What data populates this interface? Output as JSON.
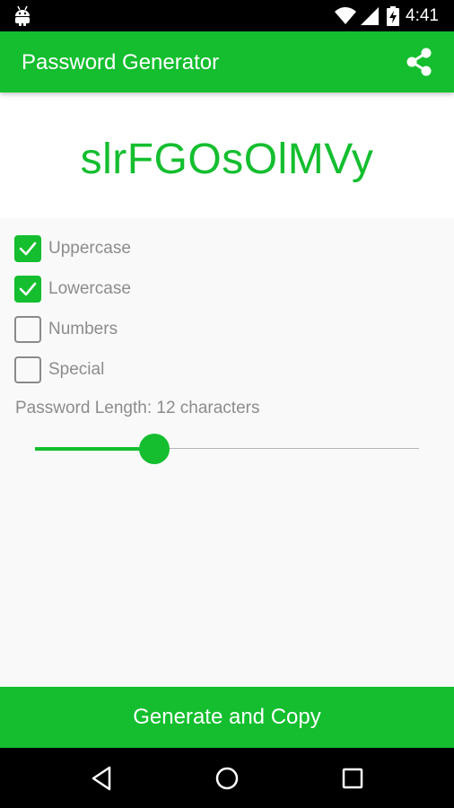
{
  "status_bar": {
    "time": "4:41",
    "icons": [
      "android-icon",
      "wifi-icon",
      "signal-icon",
      "battery-charging-icon"
    ]
  },
  "app_bar": {
    "title": "Password Generator",
    "action_icon": "share-icon"
  },
  "password": {
    "value": "slrFGOsOlMVy"
  },
  "options": [
    {
      "label": "Uppercase",
      "checked": true
    },
    {
      "label": "Lowercase",
      "checked": true
    },
    {
      "label": "Numbers",
      "checked": false
    },
    {
      "label": "Special",
      "checked": false
    }
  ],
  "length": {
    "label": "Password Length: 12 characters",
    "value_fraction": 0.31
  },
  "generate_button": {
    "label": "Generate and Copy"
  },
  "nav_bar": {
    "icons": [
      "back-icon",
      "home-icon",
      "recents-icon"
    ]
  },
  "colors": {
    "accent": "#14be2f",
    "label_gray": "#8c8c8c",
    "background": "#f9f9f9"
  }
}
